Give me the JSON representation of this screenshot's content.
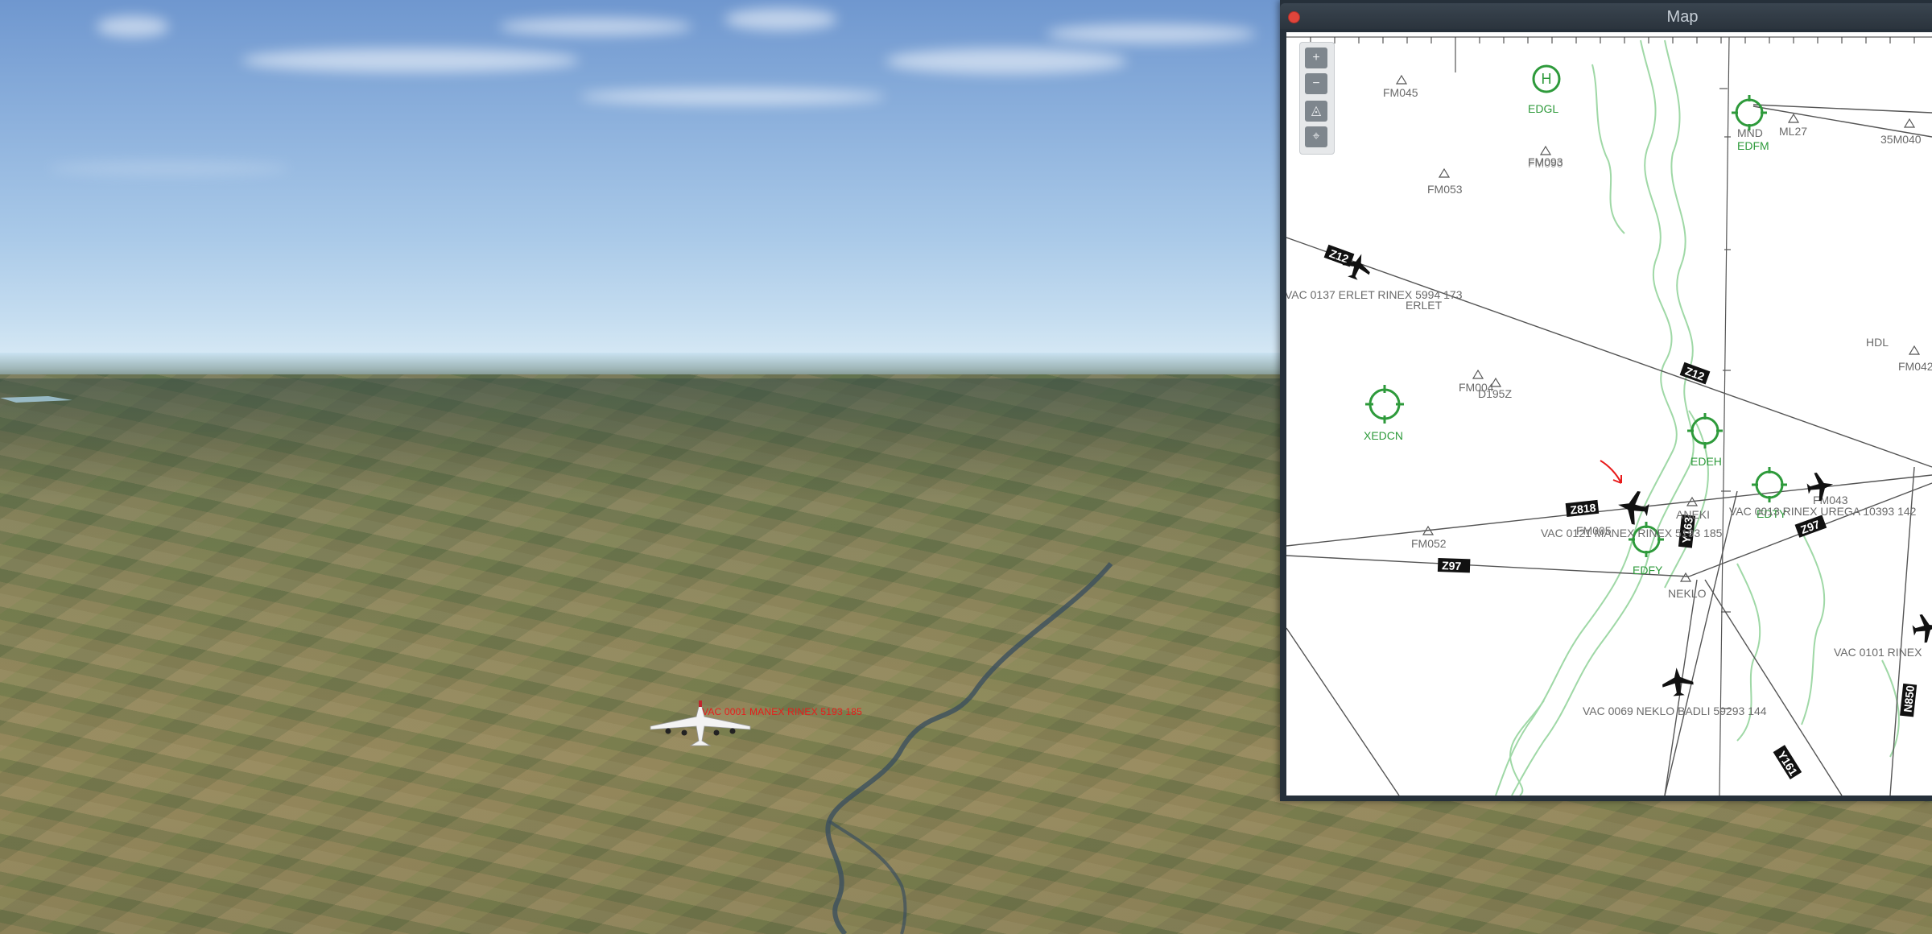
{
  "window": {
    "title": "Map"
  },
  "aircraft": {
    "label": "VAC 0001 MANEX RINEX 5193 185"
  },
  "map_controls": [
    {
      "name": "zoom-in-button",
      "glyph": "+"
    },
    {
      "name": "zoom-out-button",
      "glyph": "−"
    },
    {
      "name": "toggle-3d-button",
      "glyph": "◬"
    },
    {
      "name": "center-button",
      "glyph": "⌖"
    }
  ],
  "map": {
    "fixes": [
      "FM045",
      "FM093",
      "FM090",
      "FM053",
      "ERLET",
      "FM004",
      "D195Z",
      "FM052",
      "FM005",
      "ANEKI",
      "NEKLO",
      "FM043",
      "FM042",
      "HDL",
      "ML27",
      "MND",
      "35M040"
    ],
    "airports": [
      "EDGL",
      "EDFM",
      "XEDCN",
      "EDEH",
      "EDFY",
      "EDTY"
    ],
    "airways": [
      "Z12",
      "Z12",
      "Z818",
      "Z97",
      "Z97",
      "Y163",
      "Y161",
      "N850"
    ],
    "traffic_labels": [
      "VAC 0137 ERLET RINEX 5994 173",
      "VAC 0121 MANEX RINEX 5193 185",
      "VAC 0013 RINEX UREGA 10393 142",
      "VAC 0069 NEKLO BADLI 59293 144",
      "VAC 0101 RINEX"
    ]
  },
  "colors": {
    "airport_green": "#2e9a3b",
    "coast_green": "#9fd8a6",
    "route_gray": "#555555",
    "label_gray": "#6a6a6a",
    "aircraft_label_red": "#e81b1b",
    "close_button_red": "#e0453b",
    "titlebar": "#2b343d"
  }
}
